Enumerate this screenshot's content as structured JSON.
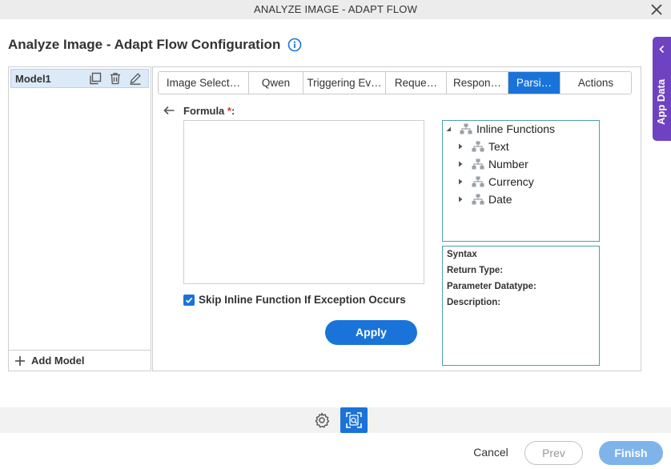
{
  "window": {
    "title": "ANALYZE IMAGE - ADAPT FLOW"
  },
  "page": {
    "heading": "Analyze Image - Adapt Flow Configuration"
  },
  "side_tab": {
    "label": "App Data"
  },
  "models": {
    "items": [
      {
        "name": "Model1"
      }
    ],
    "add_label": "Add Model"
  },
  "tabs": [
    {
      "label": "Image Select…"
    },
    {
      "label": "Qwen"
    },
    {
      "label": "Triggering Ev…"
    },
    {
      "label": "Reque…"
    },
    {
      "label": "Respon…"
    },
    {
      "label": "Parsi…",
      "active": true
    },
    {
      "label": "Actions"
    }
  ],
  "formula": {
    "label": "Formula",
    "required_mark": "*",
    "suffix": ":",
    "value": ""
  },
  "skip_option": {
    "label": "Skip Inline Function If Exception Occurs",
    "checked": true
  },
  "apply_label": "Apply",
  "tree": {
    "root": "Inline Functions",
    "children": [
      "Text",
      "Number",
      "Currency",
      "Date"
    ]
  },
  "syntax": {
    "syntax_label": "Syntax",
    "return_type_label": "Return Type:",
    "parameter_datatype_label": "Parameter Datatype:",
    "description_label": "Description:"
  },
  "footer": {
    "cancel_label": "Cancel",
    "prev_label": "Prev",
    "finish_label": "Finish"
  },
  "colors": {
    "accent": "#1a73d9",
    "side_tab": "#6f42c1",
    "required": "#d9342b",
    "finish_disabled": "#7fb4ea"
  }
}
